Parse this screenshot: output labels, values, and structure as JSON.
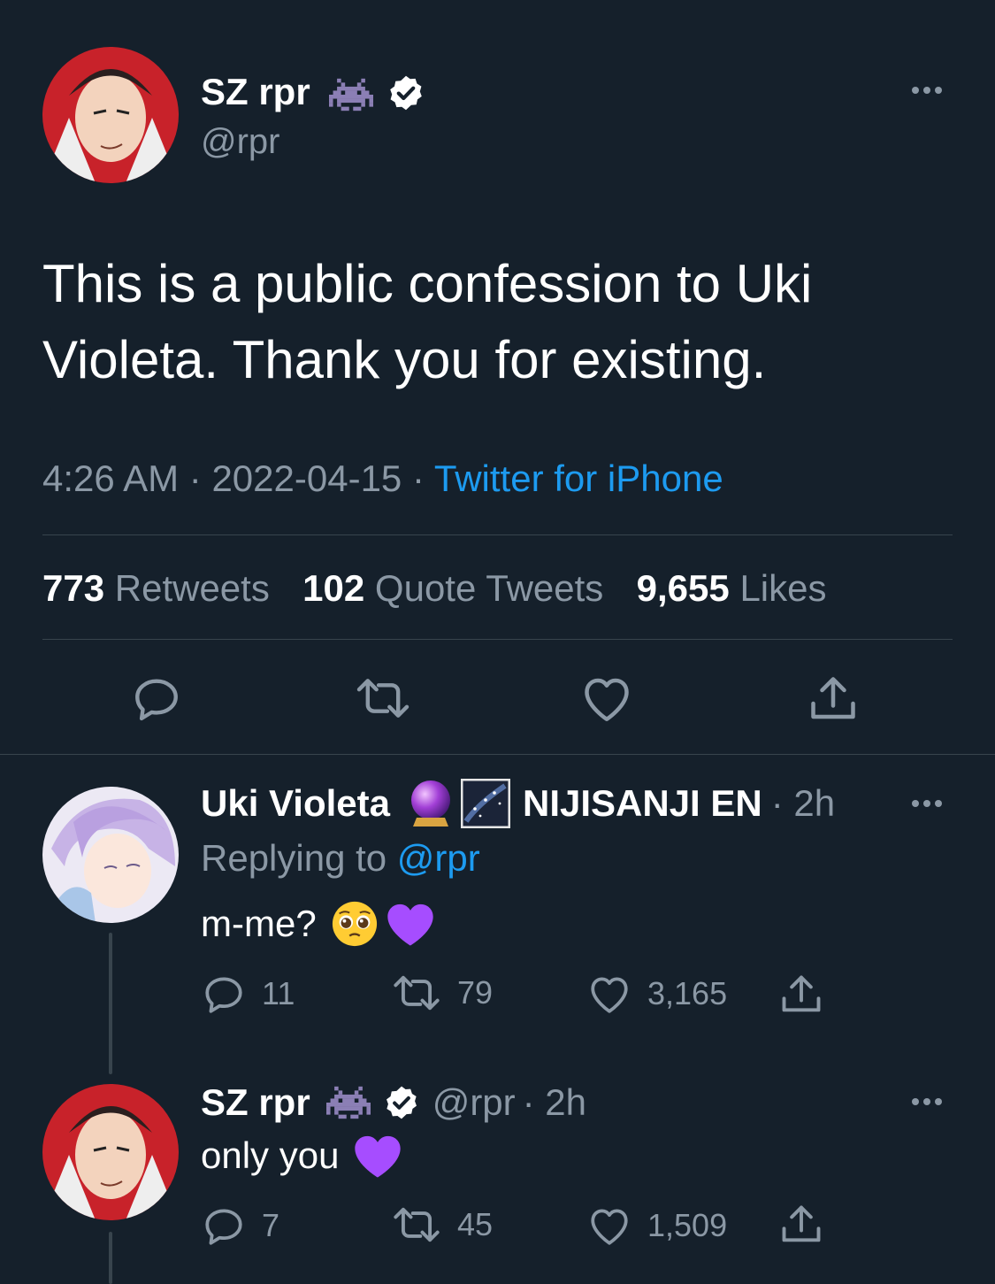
{
  "main_tweet": {
    "author": {
      "name": "SZ rpr",
      "handle": "@rpr"
    },
    "text": "This is a public confession to Uki Violeta. Thank you for existing.",
    "time": "4:26 AM",
    "date": "2022-04-15",
    "source": "Twitter for iPhone",
    "sep": "·",
    "stats": {
      "retweets_count": "773",
      "retweets_label": "Retweets",
      "quotes_count": "102",
      "quotes_label": "Quote Tweets",
      "likes_count": "9,655",
      "likes_label": "Likes"
    }
  },
  "reply1": {
    "author_name": "Uki Violeta",
    "org": "NIJISANJI EN",
    "time": "· 2h",
    "replying_prefix": "Replying to",
    "replying_handle": "@rpr",
    "text": "m-me?",
    "replies": "11",
    "retweets": "79",
    "likes": "3,165"
  },
  "reply2": {
    "author_name": "SZ rpr",
    "handle": "@rpr",
    "time": "· 2h",
    "text": "only you",
    "replies": "7",
    "retweets": "45",
    "likes": "1,509"
  },
  "colors": {
    "background": "#15202b",
    "muted": "#8b98a5",
    "link": "#1d9bf0",
    "purple_heart": "#a64dff"
  },
  "icons": [
    "invader-icon",
    "verified-icon",
    "crystal-ball-icon",
    "night-sky-icon",
    "pleading-face-icon",
    "purple-heart-icon",
    "reply-icon",
    "retweet-icon",
    "like-icon",
    "share-icon",
    "more-icon"
  ]
}
